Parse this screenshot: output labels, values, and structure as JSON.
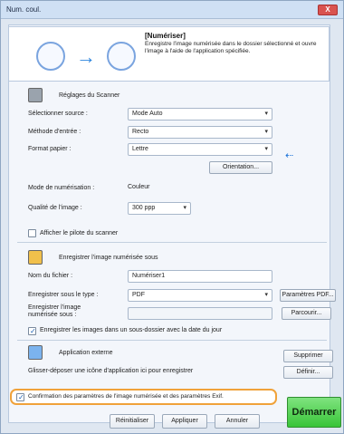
{
  "window": {
    "title": "Num. coul.",
    "close_glyph": "X"
  },
  "header": {
    "title": "[Numériser]",
    "description": "Enregistre l'image numérisée dans le dossier sélectionné et ouvre l'image à l'aide de l'application spécifiée.",
    "arrow_glyph": "→"
  },
  "scanner": {
    "section_title": "Réglages du Scanner",
    "source_label": "Sélectionner source :",
    "source_value": "Mode Auto",
    "input_method_label": "Méthode d'entrée :",
    "input_method_value": "Recto",
    "paper_label": "Format papier :",
    "paper_value": "Lettre",
    "orientation_button": "Orientation...",
    "scan_mode_label": "Mode de numérisation :",
    "scan_mode_value": "Couleur",
    "quality_label": "Qualité de l'image :",
    "quality_value": "300 ppp",
    "show_driver_label": "Afficher le pilote du scanner",
    "show_driver_checked": false,
    "link_icon_glyph": "⇠"
  },
  "save": {
    "section_title": "Enregistrer l'image numérisée sous",
    "filename_label": "Nom du fichier :",
    "filename_value": "Numériser1",
    "type_label": "Enregistrer sous le type :",
    "type_value": "PDF",
    "pdf_settings_button": "Paramètres PDF...",
    "location_label": "Enregistrer l'image numérisée sous :",
    "browse_button": "Parcourir...",
    "subfolder_label": "Enregistrer les images dans un sous-dossier avec la date du jour",
    "subfolder_checked": true
  },
  "external_app": {
    "section_title": "Application externe",
    "delete_button": "Supprimer",
    "drag_text": "Glisser-déposer une icône d'application ici pour enregistrer",
    "define_button": "Définir..."
  },
  "footer": {
    "confirm_label": "Confirmation des paramètres de l'image numérisée et des paramètres Exif.",
    "confirm_checked": true,
    "reset_button": "Réinitialiser",
    "apply_button": "Appliquer",
    "cancel_button": "Annuler",
    "start_button": "Démarrer"
  },
  "colors": {
    "accent": "#f0a23a",
    "start_green": "#39c539",
    "titlebar": "#cfe0f4",
    "close_red": "#d9534f"
  }
}
